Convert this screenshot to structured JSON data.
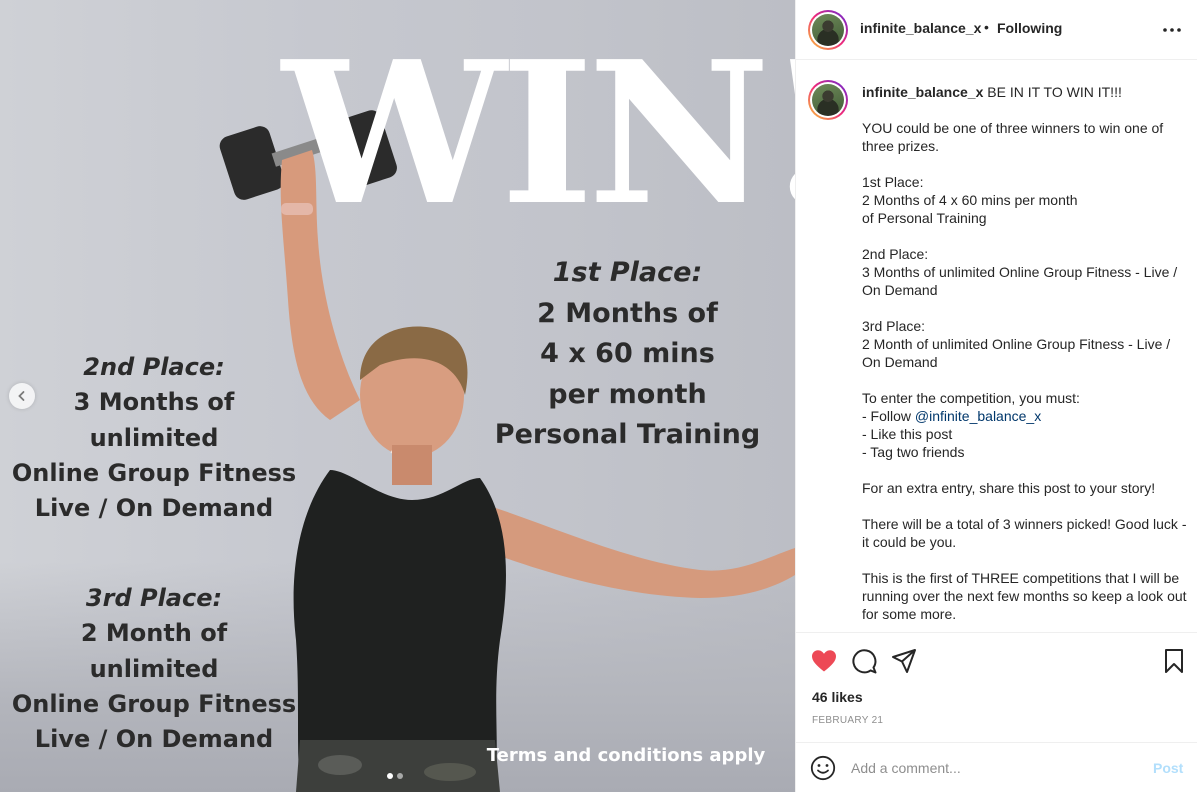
{
  "post": {
    "media": {
      "headline": "WIN!",
      "first_place": {
        "heading": "1st Place:",
        "lines": [
          "2 Months of",
          "4 x 60 mins",
          "per month",
          "Personal Training"
        ]
      },
      "second_place": {
        "heading": "2nd Place:",
        "lines": [
          "3 Months of",
          "unlimited",
          "Online Group Fitness",
          "Live / On Demand"
        ]
      },
      "third_place": {
        "heading": "3rd Place:",
        "lines": [
          "2 Month of",
          "unlimited",
          "Online Group Fitness",
          "Live / On Demand"
        ]
      },
      "terms": "Terms and conditions apply",
      "carousel": {
        "current": 1,
        "total": 2
      }
    },
    "header": {
      "username": "infinite_balance_x",
      "separator": "•",
      "follow_status": "Following",
      "more_icon": "more-horizontal-icon"
    },
    "caption": {
      "username": "infinite_balance_x",
      "first_line": "BE IN IT TO WIN IT!!!",
      "lines": [
        "",
        "YOU could be one of three winners to win one of three prizes.",
        "",
        "1st Place:",
        "2 Months of 4 x 60 mins per month",
        "of Personal Training",
        "",
        "2nd Place:",
        "3 Months of unlimited Online Group Fitness - Live / On Demand",
        "",
        "3rd Place:",
        "2 Month of unlimited Online Group Fitness - Live / On Demand",
        "",
        "To enter the competition, you must:"
      ],
      "follow_prefix": "- Follow ",
      "mention": "@infinite_balance_x",
      "lines_after": [
        "- Like this post",
        "- Tag two friends",
        "",
        "For an extra entry, share this post to your story!",
        "",
        "There will be a total of 3 winners picked! Good luck - it could be you.",
        "",
        "This is the first of THREE competitions that I will be running over the next few months so keep a look out for some more."
      ]
    },
    "actions": {
      "like_icon": "heart-filled-icon",
      "comment_icon": "comment-icon",
      "share_icon": "share-icon",
      "save_icon": "bookmark-icon",
      "liked": true,
      "like_color": "#ed4956"
    },
    "likes_text": "46 likes",
    "date": "FEBRUARY 21",
    "comment_box": {
      "emoji_icon": "emoji-icon",
      "placeholder": "Add a comment...",
      "post_label": "Post"
    },
    "colors": {
      "mention": "#00376b",
      "post_button_disabled": "#b2dffc"
    }
  }
}
